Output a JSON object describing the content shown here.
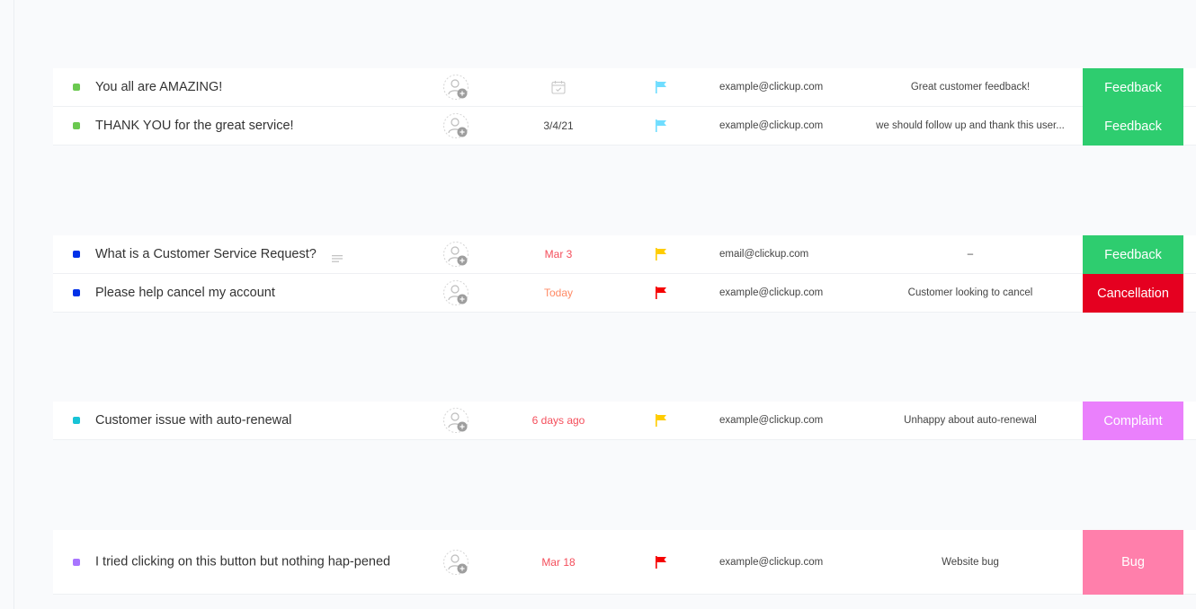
{
  "colors": {
    "status_green": "#6bc950",
    "status_blue": "#0231e8",
    "status_teal": "#17c3d6",
    "status_purple": "#a875ff",
    "flag_lightblue": "#6fddff",
    "flag_yellow": "#ffcc00",
    "flag_red": "#f50000",
    "tag_feedback": "#2ecd6f",
    "tag_cancellation": "#e50020",
    "tag_complaint": "#ea80fc",
    "tag_bug": "#ff7fab",
    "date_overdue": "#f44e5b",
    "date_today": "#ff8a65"
  },
  "groups": [
    {
      "rows": [
        {
          "status_color": "#6bc950",
          "name": "You all are AMAZING!",
          "has_description": false,
          "assignee_icon": "add-assignee-icon",
          "date": "",
          "date_icon": "calendar-icon",
          "date_color": "#444444",
          "priority_flag": "flag-icon",
          "priority_color": "#6fddff",
          "email": "example@clickup.com",
          "note": "Great customer feedback!",
          "tag": "Feedback",
          "tag_color": "#2ecd6f"
        },
        {
          "status_color": "#6bc950",
          "name": "THANK YOU for the great service!",
          "has_description": false,
          "assignee_icon": "add-assignee-icon",
          "date": "3/4/21",
          "date_color": "#444444",
          "priority_flag": "flag-icon",
          "priority_color": "#6fddff",
          "email": "example@clickup.com",
          "note": "we should follow up and thank this user...",
          "tag": "Feedback",
          "tag_color": "#2ecd6f"
        }
      ]
    },
    {
      "rows": [
        {
          "status_color": "#0231e8",
          "name": "What is a Customer Service Request?",
          "has_description": true,
          "description_icon": "description-lines-icon",
          "assignee_icon": "add-assignee-icon",
          "date": "Mar 3",
          "date_color": "#f44e5b",
          "priority_flag": "flag-icon",
          "priority_color": "#ffcc00",
          "email": "email@clickup.com",
          "note": "–",
          "tag": "Feedback",
          "tag_color": "#2ecd6f"
        },
        {
          "status_color": "#0231e8",
          "name": "Please help cancel my account",
          "has_description": false,
          "assignee_icon": "add-assignee-icon",
          "date": "Today",
          "date_color": "#ff8a65",
          "priority_flag": "flag-icon",
          "priority_color": "#f50000",
          "email": "example@clickup.com",
          "note": "Customer looking to cancel",
          "tag": "Cancellation",
          "tag_color": "#e50020"
        }
      ]
    },
    {
      "rows": [
        {
          "status_color": "#17c3d6",
          "name": "Customer issue with auto-renewal",
          "has_description": false,
          "assignee_icon": "add-assignee-icon",
          "date": "6 days ago",
          "date_color": "#f44e5b",
          "priority_flag": "flag-icon",
          "priority_color": "#ffcc00",
          "email": "example@clickup.com",
          "note": "Unhappy about auto-renewal",
          "tag": "Complaint",
          "tag_color": "#ea80fc"
        }
      ]
    },
    {
      "rows": [
        {
          "status_color": "#a875ff",
          "name": "I tried clicking on this button but nothing hap-pened",
          "has_description": false,
          "assignee_icon": "add-assignee-icon",
          "date": "Mar 18",
          "date_color": "#f44e5b",
          "priority_flag": "flag-icon",
          "priority_color": "#f50000",
          "email": "example@clickup.com",
          "note": "Website bug",
          "tag": "Bug",
          "tag_color": "#ff7fab"
        }
      ]
    }
  ]
}
